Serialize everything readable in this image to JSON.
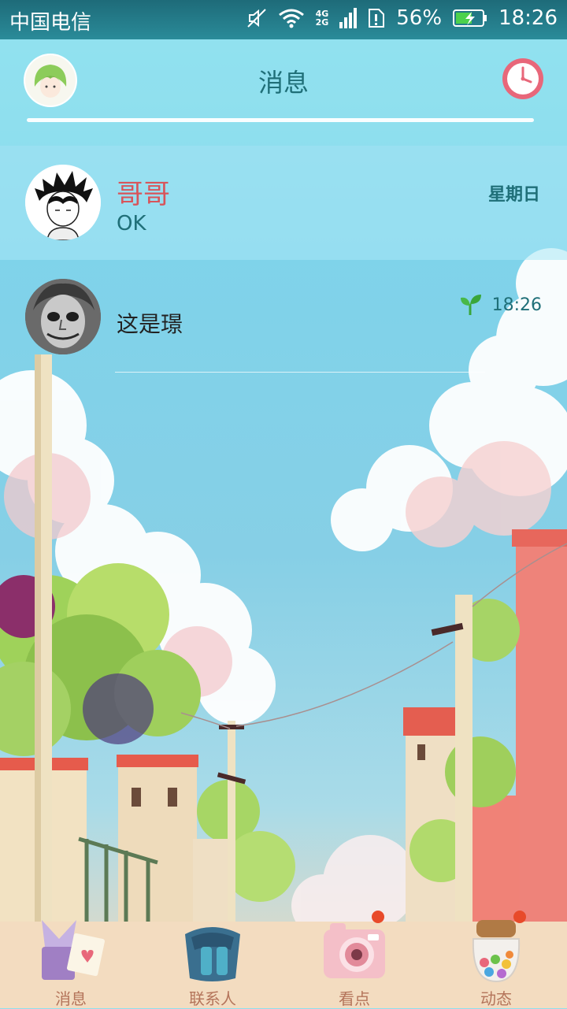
{
  "status_bar": {
    "carrier": "中国电信",
    "network_top": "4G",
    "network_bottom": "2G",
    "battery": "56%",
    "time": "18:26"
  },
  "header": {
    "title": "消息"
  },
  "conversations": [
    {
      "name": "哥哥",
      "preview": "OK",
      "time": "星期日"
    },
    {
      "name": "这是璟",
      "preview": "",
      "time": "18:26"
    }
  ],
  "tabs": [
    {
      "label": "消息",
      "icon": "gift-bag-icon"
    },
    {
      "label": "联系人",
      "icon": "backpack-icon"
    },
    {
      "label": "看点",
      "icon": "camera-icon"
    },
    {
      "label": "动态",
      "icon": "candy-jar-icon"
    }
  ],
  "colors": {
    "accent": "#1f6f78",
    "name_highlight": "#d8545a",
    "tab_label": "#b4745a",
    "badge": "#e84a2a"
  }
}
